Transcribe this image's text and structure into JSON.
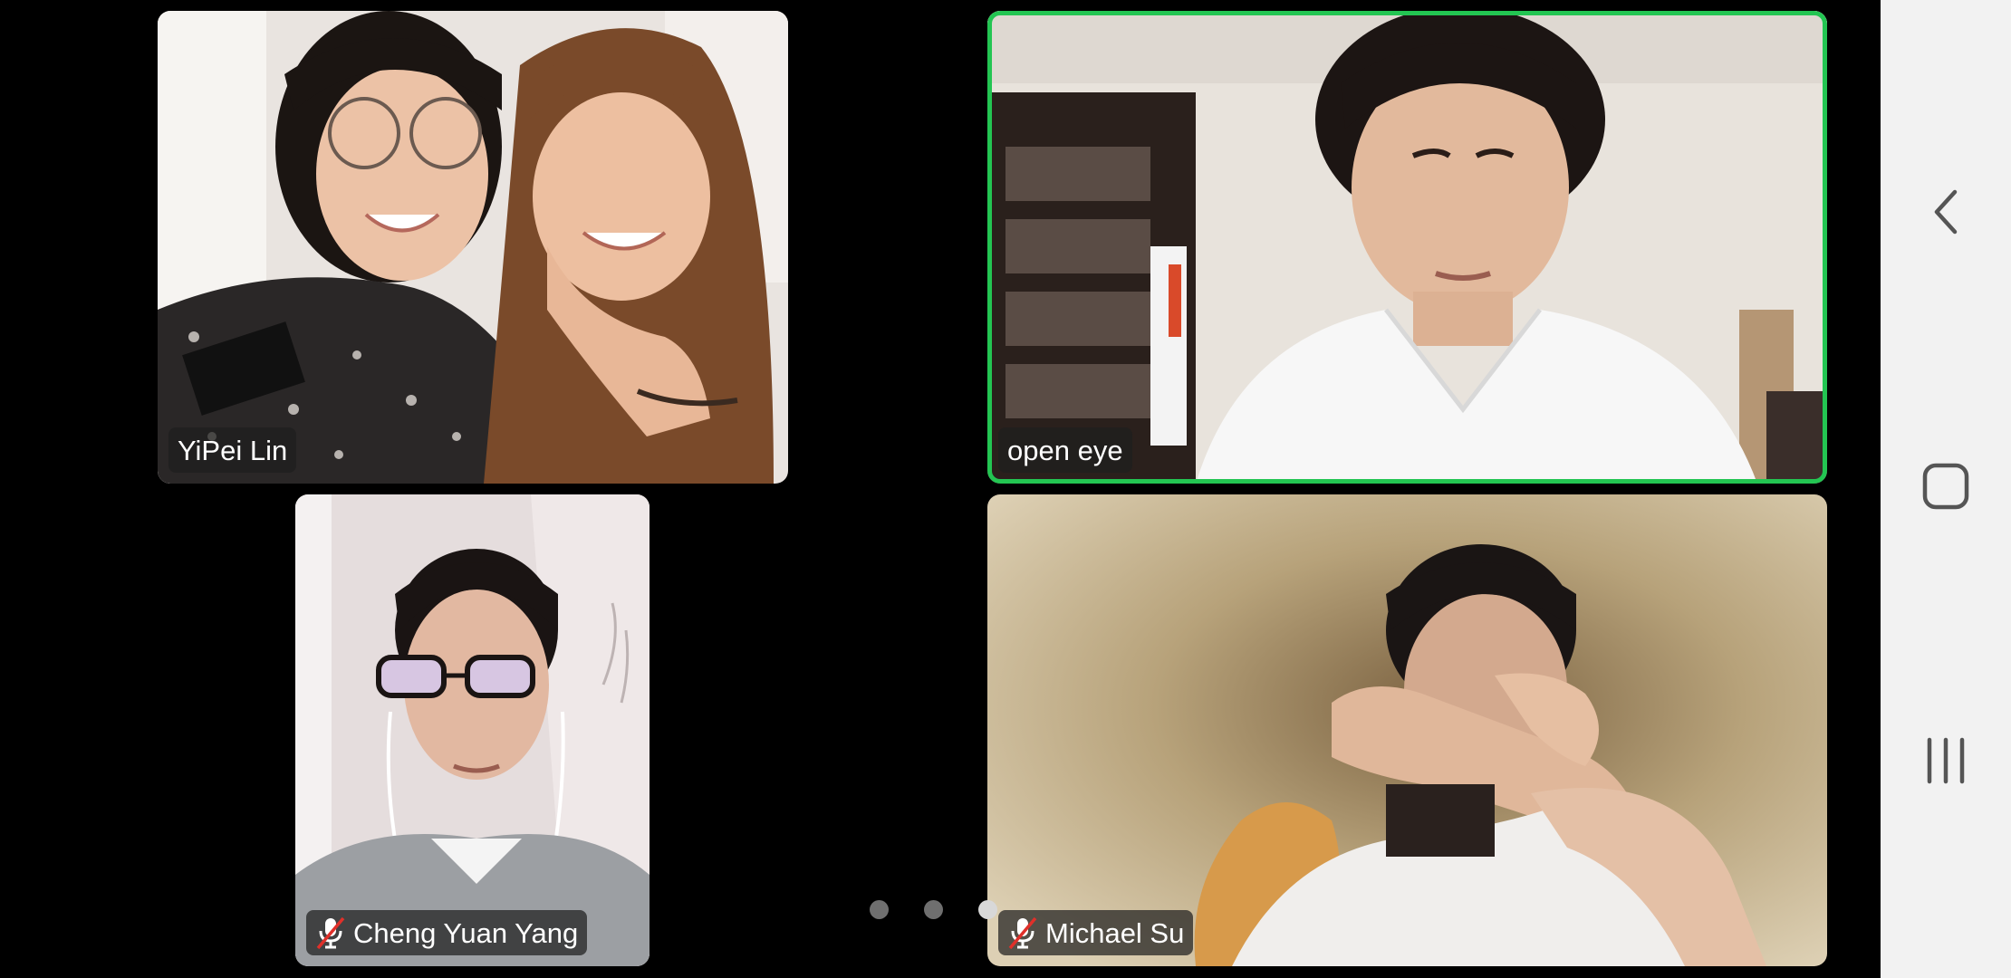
{
  "meeting": {
    "participants": [
      {
        "name": "YiPei Lin",
        "muted": false,
        "active_speaker": false
      },
      {
        "name": "open eye",
        "muted": false,
        "active_speaker": true
      },
      {
        "name": "Cheng Yuan Yang",
        "muted": true,
        "active_speaker": false
      },
      {
        "name": "Michael Su",
        "muted": true,
        "active_speaker": false
      }
    ],
    "pages": {
      "count": 3,
      "current": 3
    }
  },
  "icons": {
    "muted": "mic-muted-icon",
    "back": "chevron-left-icon",
    "home": "rounded-square-icon",
    "recents": "three-bars-icon"
  },
  "colors": {
    "active_speaker_border": "#23c552",
    "background": "#000000",
    "nav_bar": "#f2f2f2",
    "muted_slash": "#e0302a"
  }
}
